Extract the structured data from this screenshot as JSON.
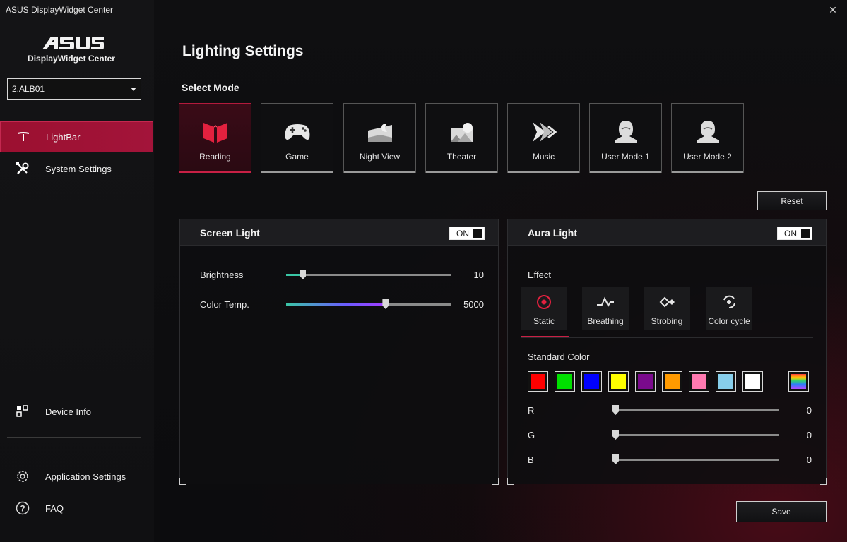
{
  "window": {
    "title": "ASUS DisplayWidget Center",
    "minimize_glyph": "—",
    "close_glyph": "✕"
  },
  "sidebar": {
    "brand_name": "DisplayWidget Center",
    "device_selected": "2.ALB01",
    "items": [
      {
        "label": "LightBar",
        "icon": "lightbar-icon",
        "active": true
      },
      {
        "label": "System Settings",
        "icon": "wrench-screwdriver-icon",
        "active": false
      },
      {
        "label": "Device Info",
        "icon": "device-info-icon",
        "active": false
      },
      {
        "label": "Application Settings",
        "icon": "gear-icon",
        "active": false
      },
      {
        "label": "FAQ",
        "icon": "question-icon",
        "active": false
      }
    ]
  },
  "main": {
    "title": "Lighting Settings",
    "select_mode_label": "Select Mode",
    "modes": [
      {
        "label": "Reading",
        "icon": "reading-icon",
        "active": true
      },
      {
        "label": "Game",
        "icon": "gamepad-icon",
        "active": false
      },
      {
        "label": "Night View",
        "icon": "night-view-icon",
        "active": false
      },
      {
        "label": "Theater",
        "icon": "theater-icon",
        "active": false
      },
      {
        "label": "Music",
        "icon": "music-icon",
        "active": false
      },
      {
        "label": "User Mode 1",
        "icon": "user-icon",
        "active": false
      },
      {
        "label": "User Mode 2",
        "icon": "user-icon",
        "active": false
      }
    ],
    "reset_label": "Reset",
    "save_label": "Save"
  },
  "screen_light": {
    "title": "Screen Light",
    "toggle_label": "ON",
    "brightness": {
      "label": "Brightness",
      "value": "10",
      "fraction": 0.1
    },
    "color_temp": {
      "label": "Color Temp.",
      "value": "5000",
      "fraction": 0.6
    }
  },
  "aura_light": {
    "title": "Aura Light",
    "toggle_label": "ON",
    "effect_label": "Effect",
    "effects": [
      {
        "label": "Static",
        "icon": "static-icon",
        "active": true
      },
      {
        "label": "Breathing",
        "icon": "breathing-icon",
        "active": false
      },
      {
        "label": "Strobing",
        "icon": "strobing-icon",
        "active": false
      },
      {
        "label": "Color cycle",
        "icon": "color-cycle-icon",
        "active": false
      }
    ],
    "standard_color_label": "Standard Color",
    "swatches": [
      "#ff0000",
      "#00e000",
      "#0000ff",
      "#ffff00",
      "#7a0a8c",
      "#ff9a00",
      "#ff7ab0",
      "#87ceeb",
      "#ffffff"
    ],
    "rgb": [
      {
        "label": "R",
        "value": "0"
      },
      {
        "label": "G",
        "value": "0"
      },
      {
        "label": "B",
        "value": "0"
      }
    ]
  },
  "colors": {
    "accent": "#b31a3c",
    "accent_line": "#c82045"
  }
}
